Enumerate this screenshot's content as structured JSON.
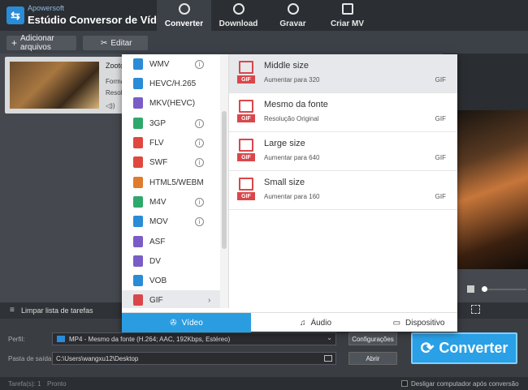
{
  "app": {
    "brand": "Apowersoft",
    "title": "Estúdio Conversor de Vídeo"
  },
  "tabs": [
    {
      "label": "Converter",
      "icon": "refresh-icon",
      "active": true
    },
    {
      "label": "Download",
      "icon": "download-icon",
      "active": false
    },
    {
      "label": "Gravar",
      "icon": "record-icon",
      "active": false
    },
    {
      "label": "Criar MV",
      "icon": "tv-icon",
      "active": false
    }
  ],
  "toolbar": {
    "add_files": "Adicionar arquivos",
    "edit": "Editar"
  },
  "file": {
    "name": "Zootop",
    "format_label": "Forma",
    "resolution_label": "Resolu"
  },
  "formats": [
    {
      "label": "WMV",
      "color": "#2a8bd6",
      "info": true
    },
    {
      "label": "HEVC/H.265",
      "color": "#2a8bd6",
      "info": false
    },
    {
      "label": "MKV(HEVC)",
      "color": "#7a5cc7",
      "info": false
    },
    {
      "label": "3GP",
      "color": "#2fa86b",
      "info": true
    },
    {
      "label": "FLV",
      "color": "#e0473e",
      "info": true
    },
    {
      "label": "SWF",
      "color": "#e0473e",
      "info": true
    },
    {
      "label": "HTML5/WEBM",
      "color": "#e07b2e",
      "info": false
    },
    {
      "label": "M4V",
      "color": "#2fa86b",
      "info": true
    },
    {
      "label": "MOV",
      "color": "#2a8bd6",
      "info": true
    },
    {
      "label": "ASF",
      "color": "#7a5cc7",
      "info": false
    },
    {
      "label": "DV",
      "color": "#7a5cc7",
      "info": false
    },
    {
      "label": "VOB",
      "color": "#2a8bd6",
      "info": false
    },
    {
      "label": "GIF",
      "color": "#d9474b",
      "info": false,
      "selected": true
    }
  ],
  "presets": [
    {
      "title": "Middle size",
      "subtitle": "Aumentar para 320",
      "format": "GIF",
      "selected": true
    },
    {
      "title": "Mesmo da fonte",
      "subtitle": "Resolução Original",
      "format": "GIF",
      "selected": false
    },
    {
      "title": "Large size",
      "subtitle": "Aumentar para 640",
      "format": "GIF",
      "selected": false
    },
    {
      "title": "Small size",
      "subtitle": "Aumentar para 160",
      "format": "GIF",
      "selected": false
    }
  ],
  "categories": [
    {
      "label": "Vídeo",
      "icon": "film-reel-icon",
      "active": true
    },
    {
      "label": "Áudio",
      "icon": "headphones-icon",
      "active": false
    },
    {
      "label": "Dispositivo",
      "icon": "devices-icon",
      "active": false
    }
  ],
  "listbar": {
    "clear": "Limpar lista de tarefas"
  },
  "bottom": {
    "profile_label": "Perfil:",
    "profile_value": "MP4 - Mesmo da fonte (H.264; AAC, 192Kbps, Estéreo)",
    "settings": "Configurações",
    "output_label": "Pasta de saída:",
    "output_value": "C:\\Users\\wangxu12\\Desktop",
    "open": "Abrir",
    "convert": "Converter"
  },
  "status": {
    "tasks": "Tarefa(s): 1",
    "state": "Pronto",
    "shutdown": "Desligar computador após conversão"
  },
  "colors": {
    "accent": "#2aa0e6",
    "gif_red": "#d9474b"
  }
}
